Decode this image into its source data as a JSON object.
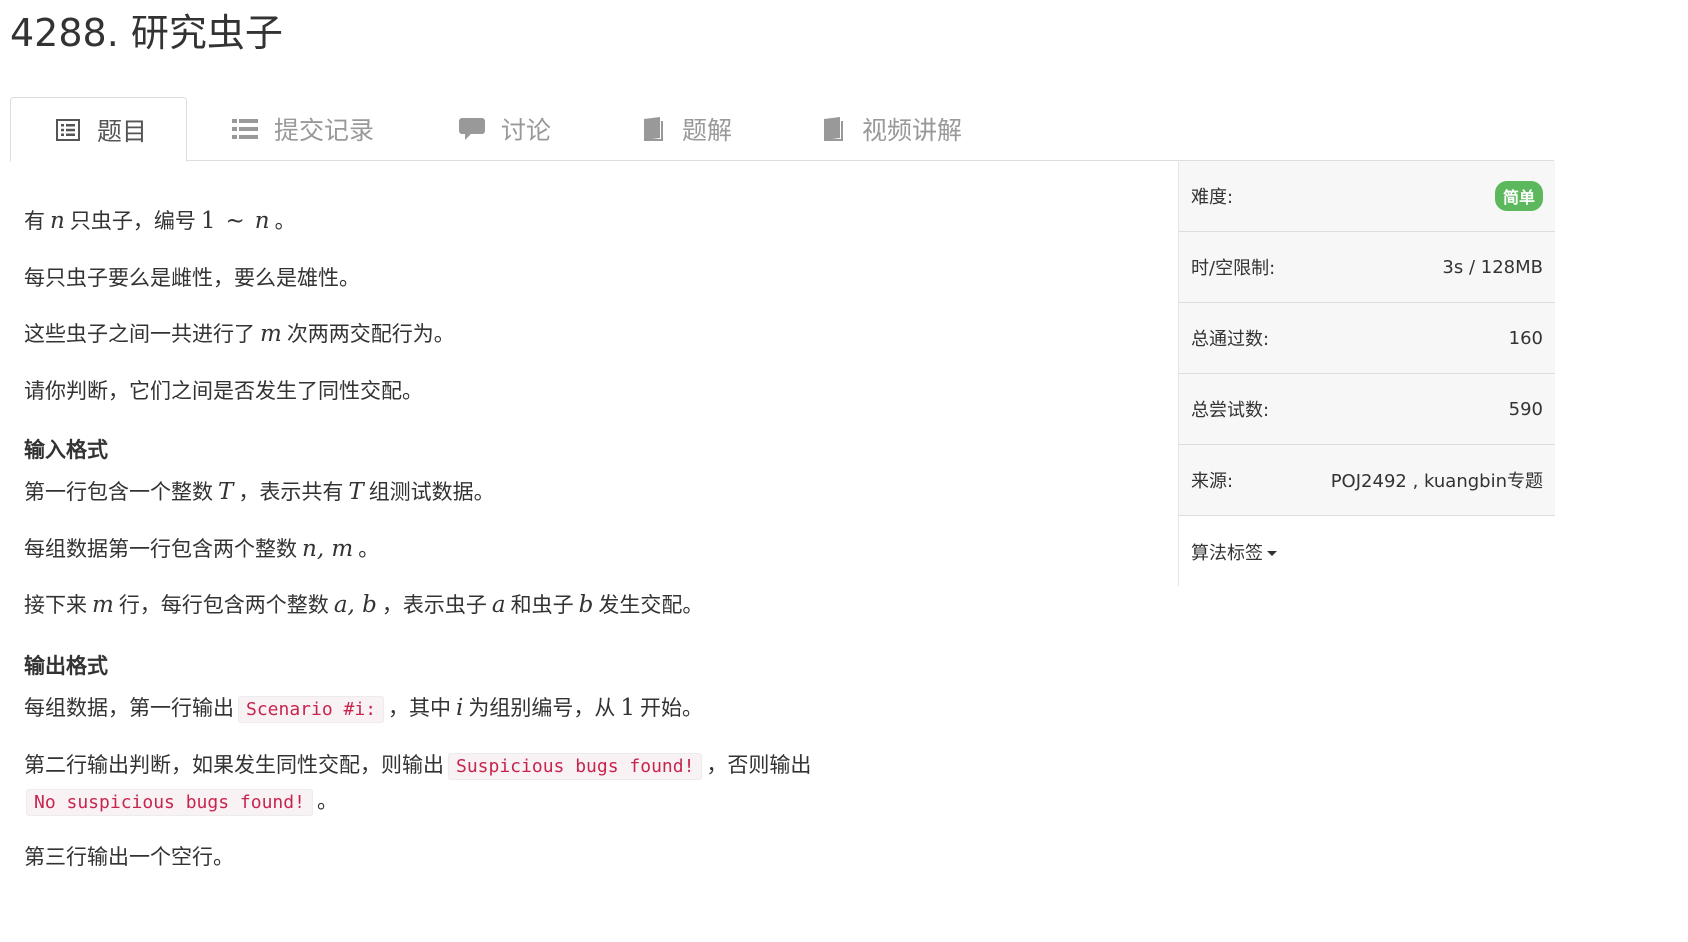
{
  "problem": {
    "title": "4288. 研究虫子"
  },
  "tabs": [
    {
      "label": "题目",
      "icon": "list-alt-icon",
      "active": true
    },
    {
      "label": "提交记录",
      "icon": "list-icon",
      "active": false
    },
    {
      "label": "讨论",
      "icon": "comment-icon",
      "active": false
    },
    {
      "label": "题解",
      "icon": "book-icon",
      "active": false
    },
    {
      "label": "视频讲解",
      "icon": "book-icon",
      "active": false
    }
  ],
  "description": {
    "p1": {
      "a": "有",
      "n": "n",
      "b": "只虫子，编号",
      "one": "1",
      "tilde": "∼",
      "n2": "n",
      "c": "。"
    },
    "p2": "每只虫子要么是雌性，要么是雄性。",
    "p3": {
      "a": "这些虫子之间一共进行了",
      "m": "m",
      "b": "次两两交配行为。"
    },
    "p4": "请你判断，它们之间是否发生了同性交配。"
  },
  "input_format": {
    "heading": "输入格式",
    "l1": {
      "a": "第一行包含一个整数",
      "T": "T",
      "b": "，表示共有",
      "T2": "T",
      "c": "组测试数据。"
    },
    "l2": {
      "a": "每组数据第一行包含两个整数",
      "nm": "n, m",
      "b": "。"
    },
    "l3": {
      "a": "接下来",
      "m": "m",
      "b": "行，每行包含两个整数",
      "ab": "a, b",
      "c": "，表示虫子",
      "a2": "a",
      "d": "和虫子",
      "b2": "b",
      "e": "发生交配。"
    }
  },
  "output_format": {
    "heading": "输出格式",
    "l1": {
      "a": "每组数据，第一行输出",
      "code": "Scenario #i:",
      "b": "，其中",
      "i": "i",
      "c": "为组别编号，从",
      "one": "1",
      "d": "开始。"
    },
    "l2": {
      "a": "第二行输出判断，如果发生同性交配，则输出",
      "code1": "Suspicious bugs found!",
      "b": "，否则输出",
      "code2": "No suspicious bugs found!",
      "c": "。"
    },
    "l3": "第三行输出一个空行。"
  },
  "info_panel": {
    "difficulty": {
      "label": "难度:",
      "value": "简单",
      "color": "#5cb85c"
    },
    "limits": {
      "label": "时/空限制:",
      "value": "3s / 128MB"
    },
    "accepted": {
      "label": "总通过数:",
      "value": "160"
    },
    "attempts": {
      "label": "总尝试数:",
      "value": "590"
    },
    "source": {
      "label": "来源:",
      "value": "POJ2492 , kuangbin专题"
    },
    "tags": {
      "label": "算法标签"
    }
  }
}
